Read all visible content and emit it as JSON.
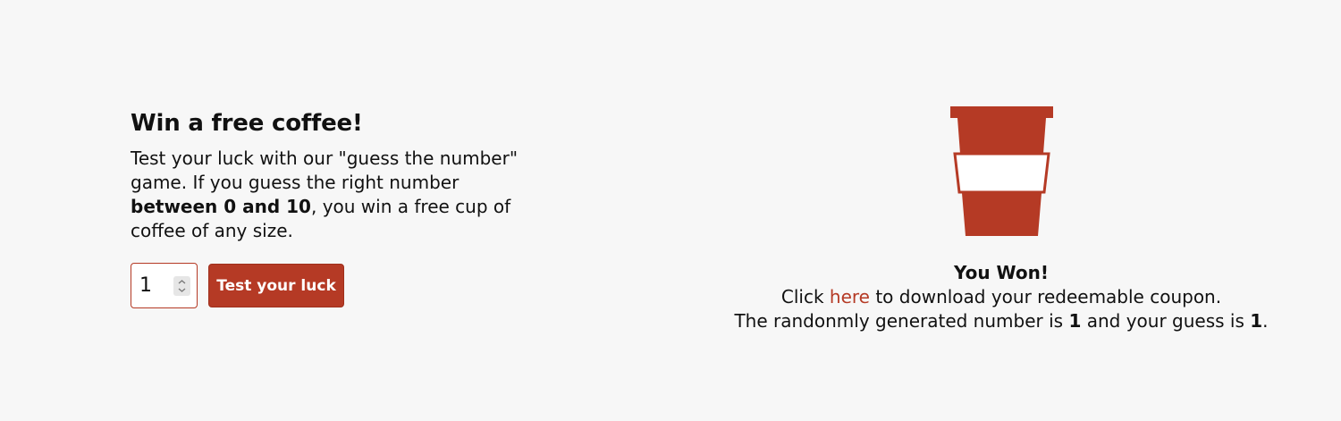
{
  "left": {
    "title": "Win a free coffee!",
    "desc_part1": "Test your luck with our \"guess the number\" game. If you guess the right number ",
    "desc_bold": "between 0 and 10",
    "desc_part2": ", you win a free cup of coffee of any size.",
    "input_value": "1",
    "button_label": "Test your luck"
  },
  "result": {
    "heading": "You Won!",
    "line1_before": "Click ",
    "line1_link": "here",
    "line1_after": " to download your redeemable coupon.",
    "line2_before": "The randonmly generated number is ",
    "generated_number": "1",
    "line2_middle": " and your guess is ",
    "guess_number": "1",
    "line2_end": "."
  },
  "icons": {
    "cup": "coffee-cup-icon",
    "spinner": "number-spinner-icon"
  },
  "colors": {
    "accent": "#b53a25",
    "background": "#f7f7f7",
    "text": "#111111"
  }
}
